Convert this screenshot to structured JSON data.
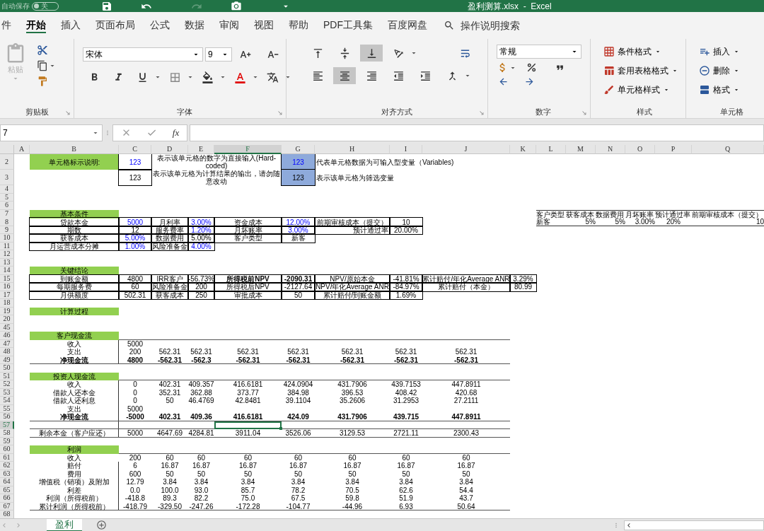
{
  "title_bar": {
    "autosave": "自动保存",
    "autosave_on": false,
    "toggle_label": "关",
    "redo_disabled": true,
    "title": "盈利测算.xlsx  -  Excel"
  },
  "menu_tabs": [
    {
      "label": "件",
      "selected": false
    },
    {
      "label": "开始",
      "selected": true
    },
    {
      "label": "插入",
      "selected": false
    },
    {
      "label": "页面布局",
      "selected": false
    },
    {
      "label": "公式",
      "selected": false
    },
    {
      "label": "数据",
      "selected": false
    },
    {
      "label": "审阅",
      "selected": false
    },
    {
      "label": "视图",
      "selected": false
    },
    {
      "label": "帮助",
      "selected": false
    },
    {
      "label": "PDF工具集",
      "selected": false
    },
    {
      "label": "百度网盘",
      "selected": false
    }
  ],
  "search": "操作说明搜索",
  "ribbon": {
    "clipboard": {
      "paste": "粘贴",
      "paste_disabled": true,
      "label": "剪贴板"
    },
    "font": {
      "name": "宋体",
      "size": "9",
      "label": "字体"
    },
    "alignment": {
      "vertical": [
        {
          "kind": "top",
          "selected": false
        },
        {
          "kind": "middle",
          "selected": false
        },
        {
          "kind": "bottom",
          "selected": true
        }
      ],
      "horizontal": [
        {
          "kind": "left",
          "selected": false
        },
        {
          "kind": "center",
          "selected": true
        },
        {
          "kind": "right",
          "selected": false
        }
      ],
      "label": "对齐方式"
    },
    "number": {
      "format": "常规",
      "label": "数字"
    },
    "styles": {
      "items": [
        "条件格式",
        "套用表格格式",
        "单元格样式"
      ],
      "label": "样式"
    },
    "cells": {
      "items": [
        "插入",
        "删除",
        "格式"
      ],
      "label": "单元格"
    }
  },
  "formula_bar": {
    "name_box": "7",
    "fx": "fx"
  },
  "sheet": {
    "columns": [
      {
        "label": "A",
        "selected": false
      },
      {
        "label": "B",
        "selected": false
      },
      {
        "label": "C",
        "selected": false
      },
      {
        "label": "D",
        "selected": false
      },
      {
        "label": "E",
        "selected": false
      },
      {
        "label": "F",
        "selected": true
      },
      {
        "label": "G",
        "selected": false
      },
      {
        "label": "H",
        "selected": false
      },
      {
        "label": "I",
        "selected": false
      },
      {
        "label": "J",
        "selected": false
      },
      {
        "label": "K",
        "selected": false
      },
      {
        "label": "L",
        "selected": false
      },
      {
        "label": "M",
        "selected": false
      },
      {
        "label": "N",
        "selected": false
      },
      {
        "label": "O",
        "selected": false
      },
      {
        "label": "P",
        "selected": false
      },
      {
        "label": "Q",
        "selected": false
      }
    ],
    "rows": [
      {
        "num": "2",
        "kind": "legend",
        "selected": false,
        "cells": [
          "",
          {
            "kind": "heading",
            "text": "单元格标示说明:"
          },
          {
            "kind": "box_input",
            "text": "123"
          },
          {
            "kind": "note",
            "text": "表示该单元格的数字为直接输入(Hard-coded)"
          },
          "",
          "",
          {
            "kind": "variable_input",
            "text": "123"
          },
          {
            "kind": "note_left",
            "text": "代表单元格数据为可输入型变量（Variables)"
          }
        ]
      },
      {
        "num": "3",
        "kind": "legend",
        "selected": false,
        "cells": [
          "",
          "",
          {
            "kind": "box",
            "text": "123"
          },
          {
            "kind": "note",
            "text": "表示该单元格为计算结果的输出，请勿随意改动"
          },
          "",
          "",
          {
            "kind": "variable",
            "text": "123"
          },
          {
            "kind": "note_left",
            "text": "表示该单元格为筛选变量"
          }
        ]
      },
      {
        "num": "4",
        "kind": "plain",
        "selected": false,
        "cells": []
      },
      {
        "num": "5",
        "kind": "plain",
        "selected": false,
        "cells": []
      },
      {
        "num": "6",
        "kind": "plain",
        "selected": false,
        "cells": []
      },
      {
        "num": "7",
        "kind": "plain",
        "selected": false,
        "cells": [
          "",
          {
            "kind": "heading",
            "text": "基本条件"
          },
          "",
          "",
          "",
          "",
          "",
          "",
          "",
          "",
          "",
          {
            "kind": "head_left",
            "text": "客户类型"
          },
          {
            "kind": "head_left",
            "text": "获客成本"
          },
          {
            "kind": "head_left",
            "text": "数据费用"
          },
          {
            "kind": "head_left",
            "text": "月坏账率"
          },
          {
            "kind": "head_left",
            "text": "预计通过率"
          },
          {
            "kind": "head_left",
            "text": "前期审核成本（提交）"
          }
        ]
      },
      {
        "num": "8",
        "kind": "plain",
        "selected": false,
        "cells": [
          "",
          {
            "kind": "box",
            "text": "贷款本金"
          },
          {
            "kind": "box_input",
            "text": "5000"
          },
          {
            "kind": "box",
            "text": "月利率"
          },
          {
            "kind": "box_input",
            "text": "3.00%"
          },
          {
            "kind": "box",
            "text": "资金成本"
          },
          {
            "kind": "box_input",
            "text": "12.00%"
          },
          {
            "kind": "box",
            "text": "前期审核成本（提交）"
          },
          {
            "kind": "box",
            "text": "10"
          },
          "",
          "",
          {
            "kind": "body_left",
            "text": "新客"
          },
          {
            "kind": "body_right",
            "text": "5%"
          },
          {
            "kind": "body_right",
            "text": "5%"
          },
          {
            "kind": "body_right",
            "text": "3.00%"
          },
          {
            "kind": "body",
            "text": "20%"
          },
          {
            "kind": "body_right",
            "text": "10"
          }
        ]
      },
      {
        "num": "9",
        "kind": "plain",
        "selected": false,
        "cells": [
          "",
          {
            "kind": "box",
            "text": "期数"
          },
          {
            "kind": "box",
            "text": "12"
          },
          {
            "kind": "box",
            "text": "服务费率"
          },
          {
            "kind": "box_input",
            "text": "1.20%"
          },
          {
            "kind": "box",
            "text": "月坏账率"
          },
          {
            "kind": "box_input",
            "text": "3.00%"
          },
          {
            "kind": "box_end",
            "text": "预计通过率"
          },
          {
            "kind": "box",
            "text": "20.00%"
          }
        ]
      },
      {
        "num": "10",
        "kind": "plain",
        "selected": false,
        "cells": [
          "",
          {
            "kind": "box",
            "text": "获客成本"
          },
          {
            "kind": "box_input",
            "text": "5.00%"
          },
          {
            "kind": "box",
            "text": "数据费用"
          },
          {
            "kind": "box",
            "text": "5.00%"
          },
          {
            "kind": "box",
            "text": "客户类型"
          },
          {
            "kind": "box",
            "text": "新客"
          }
        ]
      },
      {
        "num": "11",
        "kind": "plain",
        "selected": false,
        "cells": [
          "",
          {
            "kind": "box",
            "text": "月运营成本分摊"
          },
          {
            "kind": "box_input",
            "text": "1.00%"
          },
          {
            "kind": "box",
            "text": "风险准备金"
          },
          {
            "kind": "box_input",
            "text": "4.00%"
          }
        ]
      },
      {
        "num": "12",
        "kind": "plain",
        "selected": false,
        "cells": []
      },
      {
        "num": "13",
        "kind": "plain",
        "selected": false,
        "cells": []
      },
      {
        "num": "14",
        "kind": "plain",
        "selected": false,
        "cells": [
          "",
          {
            "kind": "heading",
            "text": "关键结论"
          }
        ]
      },
      {
        "num": "15",
        "kind": "plain",
        "selected": false,
        "cells": [
          "",
          {
            "kind": "box",
            "text": "到账金额"
          },
          {
            "kind": "box",
            "text": "4800"
          },
          {
            "kind": "box",
            "text": "IRR客户"
          },
          {
            "kind": "box",
            "text": "-56.73%"
          },
          {
            "kind": "box_bold",
            "text": "所得税前NPV"
          },
          {
            "kind": "box_bold",
            "text": "-2090.31"
          },
          {
            "kind": "box",
            "text": "NPV/原始本金"
          },
          {
            "kind": "box",
            "text": "-41.81%"
          },
          {
            "kind": "box",
            "text": "累计赔付/年化Average ANR"
          },
          {
            "kind": "box",
            "text": "3.29%"
          }
        ]
      },
      {
        "num": "16",
        "kind": "plain",
        "selected": false,
        "cells": [
          "",
          {
            "kind": "box",
            "text": "每期服务费"
          },
          {
            "kind": "box",
            "text": "60"
          },
          {
            "kind": "box",
            "text": "风险准备金"
          },
          {
            "kind": "box",
            "text": "200"
          },
          {
            "kind": "box",
            "text": "所得税后NPV"
          },
          {
            "kind": "box",
            "text": "-2127.64"
          },
          {
            "kind": "box",
            "text": "NPV/年化Average ANR"
          },
          {
            "kind": "box",
            "text": "-84.97%"
          },
          {
            "kind": "box",
            "text": "累计赔付（本金）"
          },
          {
            "kind": "box",
            "text": "80.99"
          }
        ]
      },
      {
        "num": "17",
        "kind": "plain",
        "selected": false,
        "cells": [
          "",
          {
            "kind": "box",
            "text": "月供额度"
          },
          {
            "kind": "box",
            "text": "502.31"
          },
          {
            "kind": "box",
            "text": "获客成本"
          },
          {
            "kind": "box",
            "text": "250"
          },
          {
            "kind": "box",
            "text": "审批成本"
          },
          {
            "kind": "box",
            "text": "50"
          },
          {
            "kind": "box",
            "text": "累计赔付/到账金额"
          },
          {
            "kind": "box",
            "text": "1.69%"
          }
        ]
      },
      {
        "num": "18",
        "kind": "plain",
        "selected": false,
        "cells": []
      },
      {
        "num": "19",
        "kind": "plain",
        "selected": false,
        "cells": [
          "",
          {
            "kind": "heading",
            "text": "计算过程"
          }
        ]
      },
      {
        "num": "20",
        "kind": "plain",
        "selected": false,
        "cells": []
      },
      {
        "num": "45",
        "kind": "plain",
        "selected": false,
        "cells": []
      },
      {
        "num": "46",
        "kind": "plain",
        "selected": false,
        "rule_bottom": true,
        "cells": [
          "",
          {
            "kind": "heading",
            "text": "客户现金流"
          }
        ]
      },
      {
        "num": "47",
        "kind": "flow",
        "selected": false,
        "cells": [
          "",
          {
            "kind": "plain",
            "text": "收入"
          },
          {
            "kind": "plain",
            "text": "5000"
          }
        ]
      },
      {
        "num": "48",
        "kind": "flow",
        "selected": false,
        "cells": [
          "",
          {
            "kind": "plain",
            "text": "支出"
          },
          {
            "kind": "plain",
            "text": "200"
          },
          {
            "kind": "plain",
            "text": "562.31"
          },
          {
            "kind": "plain",
            "text": "562.31"
          },
          {
            "kind": "plain",
            "text": "562.31"
          },
          {
            "kind": "plain",
            "text": "562.31"
          },
          {
            "kind": "plain",
            "text": "562.31"
          },
          {
            "kind": "plain",
            "text": "562.31"
          },
          {
            "kind": "plain",
            "text": "562.31"
          }
        ]
      },
      {
        "num": "49",
        "kind": "flow",
        "selected": false,
        "rule_bottom": true,
        "cells": [
          "",
          {
            "kind": "bold",
            "text": "净现金流"
          },
          {
            "kind": "bold",
            "text": "4800"
          },
          {
            "kind": "bold",
            "text": "-562.31"
          },
          {
            "kind": "bold",
            "text": "-562.3"
          },
          {
            "kind": "bold",
            "text": "-562.31"
          },
          {
            "kind": "bold",
            "text": "-562.31"
          },
          {
            "kind": "bold",
            "text": "-562.31"
          },
          {
            "kind": "bold",
            "text": "-562.31"
          },
          {
            "kind": "bold",
            "text": "-562.31"
          }
        ]
      },
      {
        "num": "50",
        "kind": "plain",
        "selected": false,
        "cells": []
      },
      {
        "num": "51",
        "kind": "plain",
        "selected": false,
        "rule_bottom": true,
        "cells": [
          "",
          {
            "kind": "heading",
            "text": "投资人现金流"
          }
        ]
      },
      {
        "num": "52",
        "kind": "flow",
        "selected": false,
        "cells": [
          "",
          {
            "kind": "plain",
            "text": "收入"
          },
          {
            "kind": "plain",
            "text": "0"
          },
          {
            "kind": "plain",
            "text": "402.31"
          },
          {
            "kind": "plain",
            "text": "409.357"
          },
          {
            "kind": "plain",
            "text": "416.6181"
          },
          {
            "kind": "plain",
            "text": "424.0904"
          },
          {
            "kind": "plain",
            "text": "431.7906"
          },
          {
            "kind": "plain",
            "text": "439.7153"
          },
          {
            "kind": "plain",
            "text": "447.8911"
          }
        ]
      },
      {
        "num": "53",
        "kind": "flow",
        "selected": false,
        "cells": [
          "",
          {
            "kind": "plain",
            "text": "借款人还本金"
          },
          {
            "kind": "plain",
            "text": "0"
          },
          {
            "kind": "plain",
            "text": "352.31"
          },
          {
            "kind": "plain",
            "text": "362.88"
          },
          {
            "kind": "plain",
            "text": "373.77"
          },
          {
            "kind": "plain",
            "text": "384.98"
          },
          {
            "kind": "plain",
            "text": "396.53"
          },
          {
            "kind": "plain",
            "text": "408.42"
          },
          {
            "kind": "plain",
            "text": "420.68"
          }
        ]
      },
      {
        "num": "54",
        "kind": "flow",
        "selected": false,
        "cells": [
          "",
          {
            "kind": "plain",
            "text": "借款人还利息"
          },
          {
            "kind": "plain",
            "text": "0"
          },
          {
            "kind": "plain",
            "text": "50"
          },
          {
            "kind": "plain",
            "text": "46.4769"
          },
          {
            "kind": "plain",
            "text": "42.8481"
          },
          {
            "kind": "plain",
            "text": "39.1104"
          },
          {
            "kind": "plain",
            "text": "35.2606"
          },
          {
            "kind": "plain",
            "text": "31.2953"
          },
          {
            "kind": "plain",
            "text": "27.2111"
          }
        ]
      },
      {
        "num": "55",
        "kind": "flow",
        "selected": false,
        "cells": [
          "",
          {
            "kind": "plain",
            "text": "支出"
          },
          {
            "kind": "plain",
            "text": "5000"
          }
        ]
      },
      {
        "num": "56",
        "kind": "flow",
        "selected": false,
        "rule_bottom": true,
        "cells": [
          "",
          {
            "kind": "bold",
            "text": "净现金流"
          },
          {
            "kind": "bold",
            "text": "-5000"
          },
          {
            "kind": "bold",
            "text": "402.31"
          },
          {
            "kind": "bold",
            "text": "409.36"
          },
          {
            "kind": "bold",
            "text": "416.6181"
          },
          {
            "kind": "bold",
            "text": "424.09"
          },
          {
            "kind": "bold",
            "text": "431.7906"
          },
          {
            "kind": "bold",
            "text": "439.715"
          },
          {
            "kind": "bold",
            "text": "447.8911"
          }
        ]
      },
      {
        "num": "57",
        "kind": "flow",
        "selected": true,
        "rule_bottom": true,
        "cells": []
      },
      {
        "num": "58",
        "kind": "flow",
        "selected": false,
        "rule_bottom": true,
        "cells": [
          "",
          {
            "kind": "plain",
            "text": "剩余本金（客户应还）"
          },
          {
            "kind": "plain",
            "text": "5000"
          },
          {
            "kind": "plain",
            "text": "4647.69"
          },
          {
            "kind": "plain",
            "text": "4284.81"
          },
          {
            "kind": "plain",
            "text": "3911.04"
          },
          {
            "kind": "plain",
            "text": "3526.06"
          },
          {
            "kind": "plain",
            "text": "3129.53"
          },
          {
            "kind": "plain",
            "text": "2721.11"
          },
          {
            "kind": "plain",
            "text": "2300.43"
          }
        ]
      },
      {
        "num": "59",
        "kind": "plain",
        "selected": false,
        "cells": []
      },
      {
        "num": "60",
        "kind": "plain",
        "selected": false,
        "rule_bottom": true,
        "cells": [
          "",
          {
            "kind": "heading",
            "text": "利润"
          }
        ]
      },
      {
        "num": "61",
        "kind": "plain",
        "selected": false,
        "cells": [
          "",
          {
            "kind": "plain",
            "text": "收入"
          },
          {
            "kind": "plain",
            "text": "200"
          },
          {
            "kind": "plain",
            "text": "60"
          },
          {
            "kind": "plain",
            "text": "60"
          },
          {
            "kind": "plain",
            "text": "60"
          },
          {
            "kind": "plain",
            "text": "60"
          },
          {
            "kind": "plain",
            "text": "60"
          },
          {
            "kind": "plain",
            "text": "60"
          },
          {
            "kind": "plain",
            "text": "60"
          }
        ]
      },
      {
        "num": "62",
        "kind": "flow",
        "selected": false,
        "cells": [
          "",
          {
            "kind": "plain",
            "text": "赔付"
          },
          {
            "kind": "plain",
            "text": "6"
          },
          {
            "kind": "plain",
            "text": "16.87"
          },
          {
            "kind": "plain",
            "text": "16.87"
          },
          {
            "kind": "plain",
            "text": "16.87"
          },
          {
            "kind": "plain",
            "text": "16.87"
          },
          {
            "kind": "plain",
            "text": "16.87"
          },
          {
            "kind": "plain",
            "text": "16.87"
          },
          {
            "kind": "plain",
            "text": "16.87"
          }
        ]
      },
      {
        "num": "63",
        "kind": "flow",
        "selected": false,
        "cells": [
          "",
          {
            "kind": "plain",
            "text": "费用"
          },
          {
            "kind": "plain",
            "text": "600"
          },
          {
            "kind": "plain",
            "text": "50"
          },
          {
            "kind": "plain",
            "text": "50"
          },
          {
            "kind": "plain",
            "text": "50"
          },
          {
            "kind": "plain",
            "text": "50"
          },
          {
            "kind": "plain",
            "text": "50"
          },
          {
            "kind": "plain",
            "text": "50"
          },
          {
            "kind": "plain",
            "text": "50"
          }
        ]
      },
      {
        "num": "64",
        "kind": "flow",
        "selected": false,
        "cells": [
          "",
          {
            "kind": "plain",
            "text": "增值税（销项）及附加"
          },
          {
            "kind": "plain",
            "text": "12.79"
          },
          {
            "kind": "plain",
            "text": "3.84"
          },
          {
            "kind": "plain",
            "text": "3.84"
          },
          {
            "kind": "plain",
            "text": "3.84"
          },
          {
            "kind": "plain",
            "text": "3.84"
          },
          {
            "kind": "plain",
            "text": "3.84"
          },
          {
            "kind": "plain",
            "text": "3.84"
          },
          {
            "kind": "plain",
            "text": "3.84"
          }
        ]
      },
      {
        "num": "65",
        "kind": "flow",
        "selected": false,
        "cells": [
          "",
          {
            "kind": "plain",
            "text": "利差"
          },
          {
            "kind": "plain",
            "text": "0.0"
          },
          {
            "kind": "plain",
            "text": "100.0"
          },
          {
            "kind": "plain",
            "text": "93.0"
          },
          {
            "kind": "plain",
            "text": "85.7"
          },
          {
            "kind": "plain",
            "text": "78.2"
          },
          {
            "kind": "plain",
            "text": "70.5"
          },
          {
            "kind": "plain",
            "text": "62.6"
          },
          {
            "kind": "plain",
            "text": "54.4"
          }
        ]
      },
      {
        "num": "66",
        "kind": "flow",
        "selected": false,
        "cells": [
          "",
          {
            "kind": "plain",
            "text": "利润（所得税前）"
          },
          {
            "kind": "plain",
            "text": "-418.8"
          },
          {
            "kind": "plain",
            "text": "89.3"
          },
          {
            "kind": "plain",
            "text": "82.2"
          },
          {
            "kind": "plain",
            "text": "75.0"
          },
          {
            "kind": "plain",
            "text": "67.5"
          },
          {
            "kind": "plain",
            "text": "59.8"
          },
          {
            "kind": "plain",
            "text": "51.9"
          },
          {
            "kind": "plain",
            "text": "43.7"
          }
        ]
      },
      {
        "num": "67",
        "kind": "flow",
        "selected": false,
        "rule_bottom": true,
        "cells": [
          "",
          {
            "kind": "plain",
            "text": "累计利润（所得税前）"
          },
          {
            "kind": "plain",
            "text": "-418.79"
          },
          {
            "kind": "plain",
            "text": "-329.50"
          },
          {
            "kind": "plain",
            "text": "-247.26"
          },
          {
            "kind": "plain",
            "text": "-172.28"
          },
          {
            "kind": "plain",
            "text": "-104.77"
          },
          {
            "kind": "plain",
            "text": "-44.96"
          },
          {
            "kind": "plain",
            "text": "6.93"
          },
          {
            "kind": "plain",
            "text": "50.64"
          }
        ]
      },
      {
        "num": "68",
        "kind": "plain",
        "selected": false,
        "cells": []
      }
    ]
  },
  "sheet_tabs": [
    {
      "label": "盈利",
      "selected": true
    }
  ]
}
